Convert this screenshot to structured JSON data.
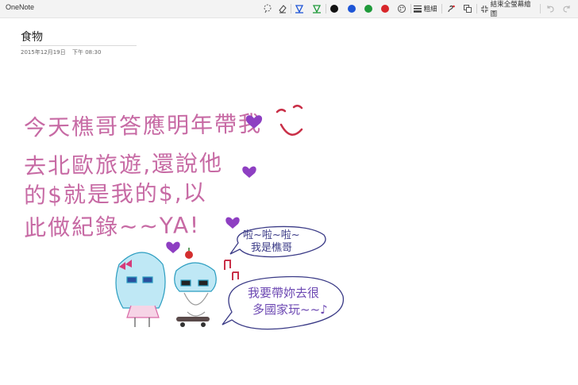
{
  "window": {
    "app_name": "OneNote"
  },
  "toolbar": {
    "lasso_icon": "lasso-select-icon",
    "eraser_icon": "eraser-icon",
    "pen_icon": "pen-icon",
    "highlighter_icon": "highlighter-icon",
    "colors": [
      {
        "name": "black",
        "hex": "#111111"
      },
      {
        "name": "blue",
        "hex": "#1e55d6"
      },
      {
        "name": "green",
        "hex": "#1f9a3a"
      },
      {
        "name": "red",
        "hex": "#d8262a"
      }
    ],
    "more_colors_icon": "palette-icon",
    "thickness_label": "粗細",
    "ink_to_text_icon": "ink-replay-icon",
    "insert_space_icon": "insert-space-icon",
    "exit_fullscreen_label": "結束全螢幕繪圖",
    "undo_icon": "undo-icon",
    "redo_icon": "redo-icon"
  },
  "page": {
    "title": "食物",
    "date": "2015年12月19日",
    "time": "下午 08:30"
  },
  "handwriting": {
    "line1": "今天樵哥答應明年帶我",
    "line2": "去北歐旅遊,還說他",
    "line3": "的$就是我的$,以",
    "line4": "此做紀錄~~YA!",
    "bubble1_line1": "啦~啦~啦~",
    "bubble1_line2": "我是樵哥",
    "bubble2_line1": "我要帶妳去很",
    "bubble2_line2": "多國家玩~~♪"
  }
}
